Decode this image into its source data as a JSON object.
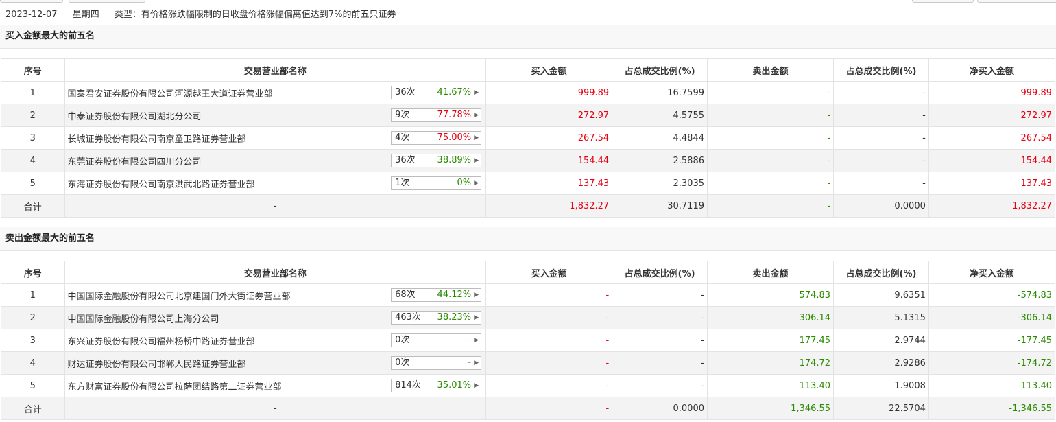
{
  "header": {
    "date": "2023-12-07",
    "weekday": "星期四",
    "type_label": "类型：有价格涨跌幅限制的日收盘价格涨幅偏离值达到7%的前五只证券"
  },
  "columns": [
    "序号",
    "交易营业部名称",
    "买入金额",
    "占总成交比例(%)",
    "卖出金额",
    "占总成交比例(%)",
    "净买入金额"
  ],
  "buy_section": {
    "title": "买入金额最大的前五名",
    "rows": [
      {
        "idx": "1",
        "name": "国泰君安证券股份有限公司河源越王大道证券营业部",
        "count": "36次",
        "rate": "41.67%",
        "rate_color": "green",
        "buy": "999.89",
        "buy_pct": "16.7599",
        "sell": "-",
        "sell_pct": "-",
        "net": "999.89"
      },
      {
        "idx": "2",
        "name": "中泰证券股份有限公司湖北分公司",
        "count": "9次",
        "rate": "77.78%",
        "rate_color": "red",
        "buy": "272.97",
        "buy_pct": "4.5755",
        "sell": "-",
        "sell_pct": "-",
        "net": "272.97"
      },
      {
        "idx": "3",
        "name": "长城证券股份有限公司南京童卫路证券营业部",
        "count": "4次",
        "rate": "75.00%",
        "rate_color": "red",
        "buy": "267.54",
        "buy_pct": "4.4844",
        "sell": "-",
        "sell_pct": "-",
        "net": "267.54"
      },
      {
        "idx": "4",
        "name": "东莞证券股份有限公司四川分公司",
        "count": "36次",
        "rate": "38.89%",
        "rate_color": "green",
        "buy": "154.44",
        "buy_pct": "2.5886",
        "sell": "-",
        "sell_pct": "-",
        "net": "154.44"
      },
      {
        "idx": "5",
        "name": "东海证券股份有限公司南京洪武北路证券营业部",
        "count": "1次",
        "rate": "0%",
        "rate_color": "green",
        "buy": "137.43",
        "buy_pct": "2.3035",
        "sell": "-",
        "sell_pct": "-",
        "net": "137.43"
      }
    ],
    "total": {
      "label": "合计",
      "name": "-",
      "buy": "1,832.27",
      "buy_pct": "30.7119",
      "sell": "-",
      "sell_pct": "0.0000",
      "net": "1,832.27"
    }
  },
  "sell_section": {
    "title": "卖出金额最大的前五名",
    "rows": [
      {
        "idx": "1",
        "name": "中国国际金融股份有限公司北京建国门外大街证券营业部",
        "count": "68次",
        "rate": "44.12%",
        "rate_color": "green",
        "buy": "-",
        "buy_pct": "-",
        "sell": "574.83",
        "sell_pct": "9.6351",
        "net": "-574.83"
      },
      {
        "idx": "2",
        "name": "中国国际金融股份有限公司上海分公司",
        "count": "463次",
        "rate": "38.23%",
        "rate_color": "green",
        "buy": "-",
        "buy_pct": "-",
        "sell": "306.14",
        "sell_pct": "5.1315",
        "net": "-306.14"
      },
      {
        "idx": "3",
        "name": "东兴证券股份有限公司福州杨桥中路证券营业部",
        "count": "0次",
        "rate": "-",
        "rate_color": "gray",
        "buy": "-",
        "buy_pct": "-",
        "sell": "177.45",
        "sell_pct": "2.9744",
        "net": "-177.45"
      },
      {
        "idx": "4",
        "name": "财达证券股份有限公司邯郸人民路证券营业部",
        "count": "0次",
        "rate": "-",
        "rate_color": "gray",
        "buy": "-",
        "buy_pct": "-",
        "sell": "174.72",
        "sell_pct": "2.9286",
        "net": "-174.72"
      },
      {
        "idx": "5",
        "name": "东方财富证券股份有限公司拉萨团结路第二证券营业部",
        "count": "814次",
        "rate": "35.01%",
        "rate_color": "green",
        "buy": "-",
        "buy_pct": "-",
        "sell": "113.40",
        "sell_pct": "1.9008",
        "net": "-113.40"
      }
    ],
    "total": {
      "label": "合计",
      "name": "-",
      "buy": "-",
      "buy_pct": "0.0000",
      "sell": "1,346.55",
      "sell_pct": "22.5704",
      "net": "-1,346.55"
    }
  },
  "colors": {
    "up": "#e60012",
    "down": "#2a8a00"
  }
}
